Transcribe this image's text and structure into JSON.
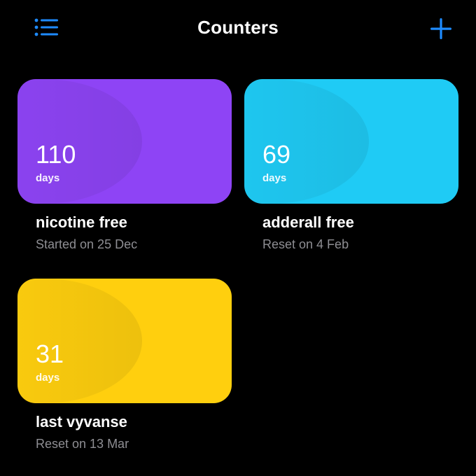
{
  "header": {
    "title": "Counters",
    "menu_icon": "list-icon",
    "add_icon": "plus-icon",
    "accent_color": "#1E8BFF"
  },
  "counters": [
    {
      "count": "110",
      "unit": "days",
      "name": "nicotine free",
      "subtitle": "Started on 25 Dec",
      "color": "#8E44F5"
    },
    {
      "count": "69",
      "unit": "days",
      "name": "adderall free",
      "subtitle": "Reset on 4 Feb",
      "color": "#1FCBF5"
    },
    {
      "count": "31",
      "unit": "days",
      "name": "last vyvanse",
      "subtitle": "Reset on 13 Mar",
      "color": "#FFCF0E"
    }
  ]
}
